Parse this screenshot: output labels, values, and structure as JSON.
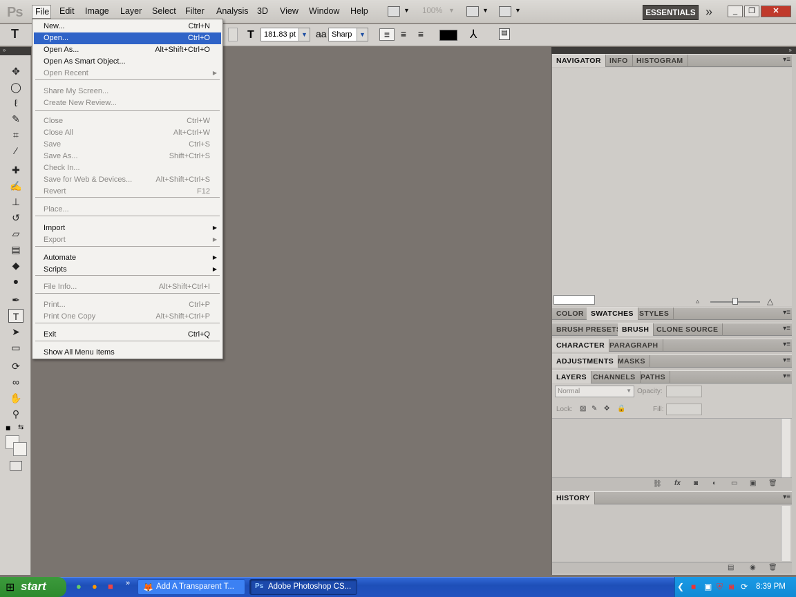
{
  "app": {
    "logo": "Ps"
  },
  "menubar": {
    "items": [
      "File",
      "Edit",
      "Image",
      "Layer",
      "Select",
      "Filter",
      "Analysis",
      "3D",
      "View",
      "Window",
      "Help"
    ],
    "zoom": "100%",
    "workspace": "ESSENTIALS",
    "more": "»",
    "window_buttons": [
      "_",
      "❐",
      "✕"
    ]
  },
  "options": {
    "tool_glyph": "T",
    "font_size_icon": "T",
    "font_size": "181.83 pt",
    "aa_icon": "aa",
    "antialias": "Sharp",
    "align": [
      "≡",
      "≡",
      "≡"
    ],
    "text_color": "#000000"
  },
  "tools": [
    {
      "name": "move-tool",
      "glyph": "✥"
    },
    {
      "name": "marquee-tool",
      "glyph": "◯"
    },
    {
      "name": "lasso-tool",
      "glyph": "ℓ"
    },
    {
      "name": "quick-selection-tool",
      "glyph": "✎"
    },
    {
      "name": "crop-tool",
      "glyph": "⌗"
    },
    {
      "name": "eyedropper-tool",
      "glyph": "⁄"
    },
    {
      "name": "healing-brush-tool",
      "glyph": "✚"
    },
    {
      "name": "brush-tool",
      "glyph": "✍"
    },
    {
      "name": "clone-stamp-tool",
      "glyph": "⊥"
    },
    {
      "name": "history-brush-tool",
      "glyph": "↺"
    },
    {
      "name": "eraser-tool",
      "glyph": "▱"
    },
    {
      "name": "gradient-tool",
      "glyph": "▤"
    },
    {
      "name": "blur-tool",
      "glyph": "◆"
    },
    {
      "name": "dodge-tool",
      "glyph": "●"
    },
    {
      "name": "pen-tool",
      "glyph": "✒"
    },
    {
      "name": "type-tool",
      "glyph": "T"
    },
    {
      "name": "path-selection-tool",
      "glyph": "➤"
    },
    {
      "name": "shape-tool",
      "glyph": "▭"
    },
    {
      "name": "3d-rotate-tool",
      "glyph": "⟳"
    },
    {
      "name": "3d-orbit-tool",
      "glyph": "∞"
    },
    {
      "name": "hand-tool",
      "glyph": "✋"
    },
    {
      "name": "zoom-tool",
      "glyph": "⚲"
    }
  ],
  "file_menu": {
    "items": [
      {
        "label": "New...",
        "shortcut": "Ctrl+N",
        "state": "normal"
      },
      {
        "label": "Open...",
        "shortcut": "Ctrl+O",
        "state": "selected"
      },
      {
        "label": "Open As...",
        "shortcut": "Alt+Shift+Ctrl+O",
        "state": "normal"
      },
      {
        "label": "Open As Smart Object...",
        "shortcut": "",
        "state": "normal"
      },
      {
        "label": "Open Recent",
        "shortcut": "",
        "state": "disabled",
        "submenu": true
      },
      {
        "label": "Share My Screen...",
        "shortcut": "",
        "state": "disabled"
      },
      {
        "label": "Create New Review...",
        "shortcut": "",
        "state": "disabled"
      },
      {
        "label": "Close",
        "shortcut": "Ctrl+W",
        "state": "disabled"
      },
      {
        "label": "Close All",
        "shortcut": "Alt+Ctrl+W",
        "state": "disabled"
      },
      {
        "label": "Save",
        "shortcut": "Ctrl+S",
        "state": "disabled"
      },
      {
        "label": "Save As...",
        "shortcut": "Shift+Ctrl+S",
        "state": "disabled"
      },
      {
        "label": "Check In...",
        "shortcut": "",
        "state": "disabled"
      },
      {
        "label": "Save for Web & Devices...",
        "shortcut": "Alt+Shift+Ctrl+S",
        "state": "disabled"
      },
      {
        "label": "Revert",
        "shortcut": "F12",
        "state": "disabled"
      },
      {
        "label": "Place...",
        "shortcut": "",
        "state": "disabled"
      },
      {
        "label": "Import",
        "shortcut": "",
        "state": "normal",
        "submenu": true
      },
      {
        "label": "Export",
        "shortcut": "",
        "state": "disabled",
        "submenu": true
      },
      {
        "label": "Automate",
        "shortcut": "",
        "state": "normal",
        "submenu": true
      },
      {
        "label": "Scripts",
        "shortcut": "",
        "state": "normal",
        "submenu": true
      },
      {
        "label": "File Info...",
        "shortcut": "Alt+Shift+Ctrl+I",
        "state": "disabled"
      },
      {
        "label": "Print...",
        "shortcut": "Ctrl+P",
        "state": "disabled"
      },
      {
        "label": "Print One Copy",
        "shortcut": "Alt+Shift+Ctrl+P",
        "state": "disabled"
      },
      {
        "label": "Exit",
        "shortcut": "Ctrl+Q",
        "state": "normal"
      },
      {
        "label": "Show All Menu Items",
        "shortcut": "",
        "state": "normal"
      }
    ]
  },
  "panels": {
    "navigator_group": [
      "NAVIGATOR",
      "INFO",
      "HISTOGRAM"
    ],
    "color_group": [
      "COLOR",
      "SWATCHES",
      "STYLES"
    ],
    "brush_group": [
      "BRUSH PRESETS",
      "BRUSH",
      "CLONE SOURCE"
    ],
    "character_group": [
      "CHARACTER",
      "PARAGRAPH"
    ],
    "adjustments_group": [
      "ADJUSTMENTS",
      "MASKS"
    ],
    "layers_group": [
      "LAYERS",
      "CHANNELS",
      "PATHS"
    ],
    "history_group": [
      "HISTORY"
    ],
    "layers": {
      "blend_mode": "Normal",
      "opacity_label": "Opacity:",
      "lock_label": "Lock:",
      "fill_label": "Fill:"
    }
  },
  "taskbar": {
    "start": "start",
    "tasks": [
      {
        "label": "Add A Transparent T...",
        "icon": "firefox-icon"
      },
      {
        "label": "Adobe Photoshop CS...",
        "icon": "photoshop-icon"
      }
    ],
    "clock": "8:39 PM"
  }
}
